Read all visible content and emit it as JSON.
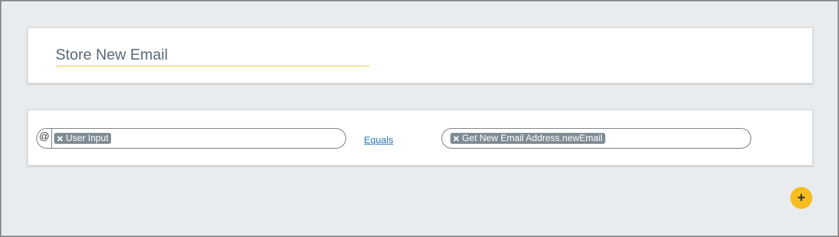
{
  "rule": {
    "title": "Store New Email"
  },
  "condition": {
    "left_prefix_icon": "at-sign-icon",
    "left_prefix_glyph": "@",
    "left_token": "User Input",
    "operator": "Equals",
    "right_token": "Get New Email Address.newEmail"
  },
  "actions": {
    "add_glyph": "+"
  },
  "icons": {
    "token_remove": "close-icon",
    "add": "plus-icon"
  },
  "colors": {
    "background": "#e9ecef",
    "title_underline": "#f2c046",
    "token_bg": "#7e8b95",
    "link": "#2874b8",
    "add_button": "#f5bd1f"
  }
}
